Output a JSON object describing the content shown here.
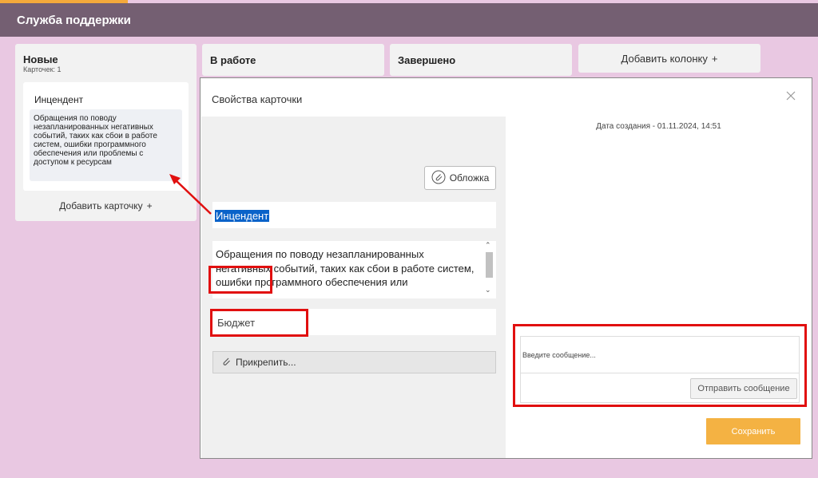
{
  "header": {
    "title": "Служба поддержки"
  },
  "colors": {
    "header": "#745f72",
    "accent": "#f4a93b",
    "background": "#e9c8e2",
    "save": "#f4b243",
    "highlight": "#e10f0f"
  },
  "board": {
    "columns": [
      {
        "title": "Новые",
        "count": "Карточек: 1"
      },
      {
        "title": "В работе"
      },
      {
        "title": "Завершено"
      }
    ],
    "add_column_label": "Добавить колонку",
    "add_card_label": "Добавить карточку",
    "plus_icon": "+"
  },
  "card": {
    "title": "Инцендент",
    "description": "Обращения по поводу незапланированных негативных событий, таких как сбои в работе систем, ошибки программного обеспечения или проблемы с доступом к ресурсам"
  },
  "modal": {
    "title": "Свойства карточки",
    "cover_label": "Обложка",
    "name_value": "Инцендент",
    "description_value": "Обращения по поводу незапланированных негативных событий, таких как сбои в работе систем, ошибки программного обеспечения или",
    "budget_value": "Бюджет",
    "attach_label": "Прикрепить...",
    "created_label": "Дата создания - 01.11.2024, 14:51",
    "message_placeholder": "Введите сообщение...",
    "send_label": "Отправить сообщение",
    "save_label": "Сохранить"
  }
}
